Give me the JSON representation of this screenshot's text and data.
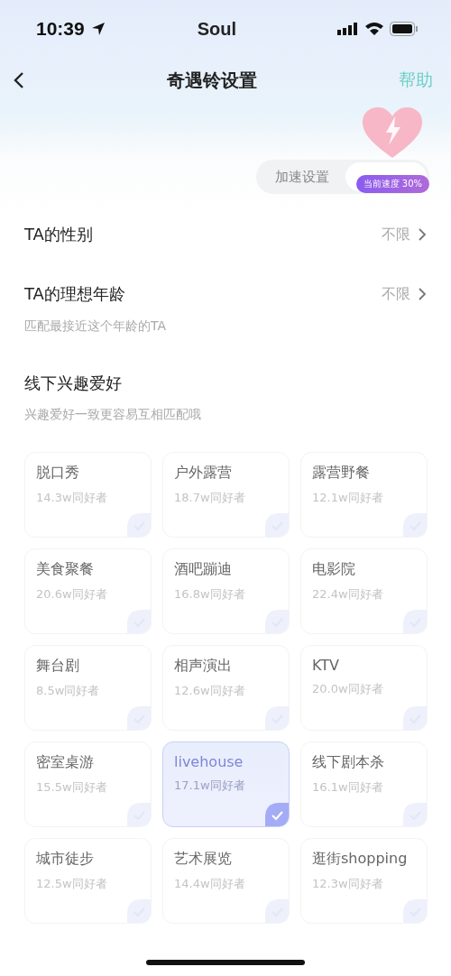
{
  "status_bar": {
    "time": "10:39",
    "carrier": "Soul"
  },
  "nav": {
    "title": "奇遇铃设置",
    "help": "帮助"
  },
  "tabs": [
    {
      "label": "加速设置",
      "selected": false
    },
    {
      "selected": true
    }
  ],
  "speed_badge": "当前速度 30%",
  "settings": [
    {
      "label": "TA的性别",
      "value": "不限"
    },
    {
      "label": "TA的理想年龄",
      "value": "不限",
      "hint": "匹配最接近这个年龄的TA"
    }
  ],
  "interests": {
    "title": "线下兴趣爱好",
    "hint": "兴趣爱好一致更容易互相匹配哦",
    "items": [
      {
        "name": "脱口秀",
        "count": "14.3w同好者",
        "selected": false
      },
      {
        "name": "户外露营",
        "count": "18.7w同好者",
        "selected": false
      },
      {
        "name": "露营野餐",
        "count": "12.1w同好者",
        "selected": false
      },
      {
        "name": "美食聚餐",
        "count": "20.6w同好者",
        "selected": false
      },
      {
        "name": "酒吧蹦迪",
        "count": "16.8w同好者",
        "selected": false
      },
      {
        "name": "电影院",
        "count": "22.4w同好者",
        "selected": false
      },
      {
        "name": "舞台剧",
        "count": "8.5w同好者",
        "selected": false
      },
      {
        "name": "相声演出",
        "count": "12.6w同好者",
        "selected": false
      },
      {
        "name": "KTV",
        "count": "20.0w同好者",
        "selected": false
      },
      {
        "name": "密室桌游",
        "count": "15.5w同好者",
        "selected": false
      },
      {
        "name": "livehouse",
        "count": "17.1w同好者",
        "selected": true
      },
      {
        "name": "线下剧本杀",
        "count": "16.1w同好者",
        "selected": false
      },
      {
        "name": "城市徒步",
        "count": "12.5w同好者",
        "selected": false
      },
      {
        "name": "艺术展览",
        "count": "14.4w同好者",
        "selected": false
      },
      {
        "name": "逛街shopping",
        "count": "12.3w同好者",
        "selected": false
      }
    ]
  }
}
